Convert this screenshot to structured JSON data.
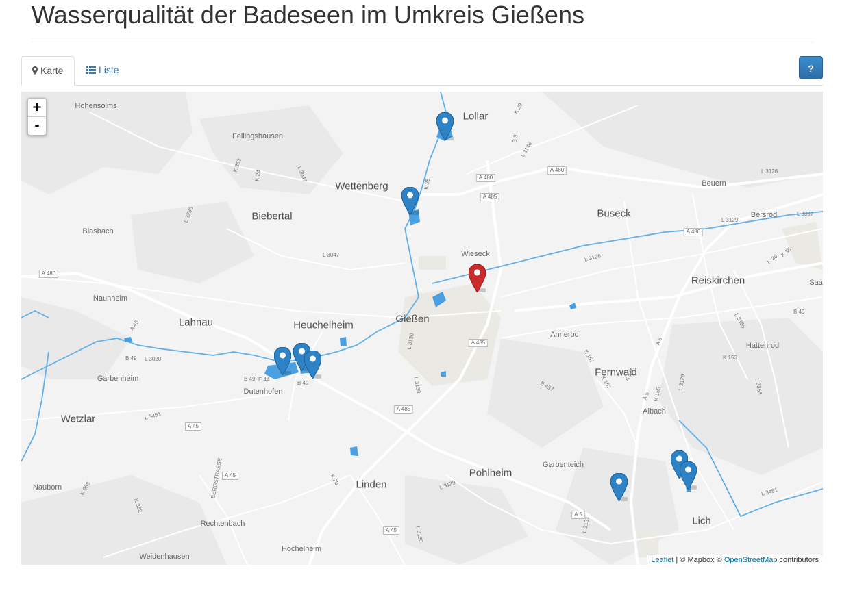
{
  "page": {
    "title": "Wasserqualität der Badeseen im Umkreis Gießens"
  },
  "tabs": [
    {
      "label": "Karte",
      "icon": "map-marker-icon",
      "active": true
    },
    {
      "label": "Liste",
      "icon": "list-icon",
      "active": false
    }
  ],
  "help_button": {
    "label": "?"
  },
  "map": {
    "zoom_in": "+",
    "zoom_out": "-",
    "places_big": [
      "Lollar",
      "Wettenberg",
      "Biebertal",
      "Buseck",
      "Reiskirchen",
      "Lahnau",
      "Heuchelheim",
      "Gießen",
      "Fernwald",
      "Wetzlar",
      "Linden",
      "Pohlheim",
      "Lich"
    ],
    "places_small": [
      "Hohensolms",
      "Fellingshausen",
      "Blasbach",
      "Beuern",
      "Bersrod",
      "Wieseck",
      "Naunheim",
      "Annerod",
      "Hattenrod",
      "Garbenheim",
      "Dutenhofen",
      "Albach",
      "Garbenteich",
      "Nauborn",
      "Rechtenbach",
      "Hochelheim",
      "Weidenhausen",
      "Saa"
    ],
    "road_shields": [
      "A 480",
      "A 480",
      "A 485",
      "A 480",
      "A 480",
      "A 485",
      "A 485",
      "A 45",
      "A 45",
      "A 45",
      "A 5"
    ],
    "road_labels": [
      "L 3286",
      "L 3047",
      "L 3047",
      "K 353",
      "K 24",
      "K 25",
      "B 3",
      "L 3146",
      "K 29",
      "L 3126",
      "L 3129",
      "L 3357",
      "L 3126",
      "K 36",
      "K 35",
      "B 49",
      "L 3355",
      "K 153",
      "A 45",
      "B 49",
      "L 3020",
      "B 49",
      "E 44",
      "B 49",
      "L 3130",
      "L 3130",
      "B 457",
      "K 157",
      "K 157",
      "K 160",
      "A 5",
      "K 155",
      "A 5",
      "L 3129",
      "L 3355",
      "L 3451",
      "BERGSTRASSE",
      "K 988",
      "K 352",
      "K 20",
      "L 3129",
      "L 3131",
      "L 3130",
      "L 3481"
    ],
    "markers": [
      {
        "color": "blue",
        "label": "marker-lollar"
      },
      {
        "color": "blue",
        "label": "marker-giessen-north"
      },
      {
        "color": "red",
        "label": "marker-wieseck"
      },
      {
        "color": "blue",
        "label": "marker-dutenhofen-1"
      },
      {
        "color": "blue",
        "label": "marker-dutenhofen-2"
      },
      {
        "color": "blue",
        "label": "marker-dutenhofen-3"
      },
      {
        "color": "blue",
        "label": "marker-lich-west"
      },
      {
        "color": "blue",
        "label": "marker-lich-1"
      },
      {
        "color": "blue",
        "label": "marker-lich-2"
      }
    ],
    "attribution": {
      "leaflet": "Leaflet",
      "sep1": " | © Mapbox © ",
      "osm": "OpenStreetMap",
      "suffix": " contributors"
    },
    "colors": {
      "water": "#4aa0e0",
      "marker_blue": "#2d83c6",
      "marker_red": "#cc2b2b",
      "background": "#f3f3f3"
    }
  }
}
